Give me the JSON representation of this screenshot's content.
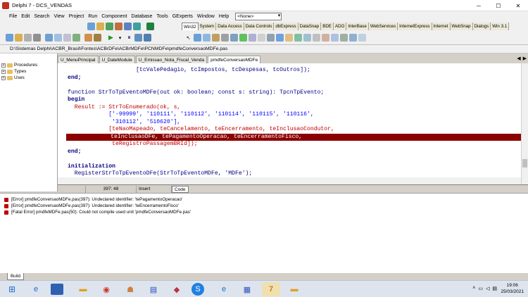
{
  "window": {
    "title": "Delphi 7 - DCS_VENDAS"
  },
  "menu": {
    "items": [
      "File",
      "Edit",
      "Search",
      "View",
      "Project",
      "Run",
      "Component",
      "Database",
      "Tools",
      "GExperts",
      "Window",
      "Help"
    ],
    "config_combo": "<None>"
  },
  "palette": {
    "tabs": [
      "Win32",
      "System",
      "Data Access",
      "Data Controls",
      "dbExpress",
      "DataSnap",
      "BDE",
      "ADO",
      "InterBase",
      "WebServices",
      "InternetExpress",
      "Internet",
      "WebSnap",
      "Dialogs",
      "Win 3.1"
    ]
  },
  "pathbar": {
    "path": "D:\\Sistemas Delphi\\ACBR_Brasil\\Fontes\\ACBrDFe\\ACBrMDFe\\PCNMDFe\\pmdfeConversaoMDFe.pas"
  },
  "tree": {
    "items": [
      "Procedures",
      "Types",
      "Uses"
    ]
  },
  "editor": {
    "tabs": [
      "U_MenuPrincipal",
      "U_DateModule",
      "U_Emissao_Nota_Fiscal_Venda",
      "pmdfeConversaoMDFe"
    ],
    "lines": [
      "                    [tcValePedagio, tcImpostos, tcDespesas, tcOutros]);",
      "end;",
      "",
      "function StrToTpEventoMDFe(out ok: boolean; const s: string): TpcnTpEvento;",
      "begin",
      "  Result := StrToEnumerado(ok, s,",
      "            ['-99999', '110111', '110112', '110114', '110115', '110116',",
      "             '310112', '510620'],",
      "            [teNaoMapeado, teCancelamento, teEncerramento, teInclusaoCondutor,",
      "             teInclusaoDFe, tePagamentoOperacao, teEncerramentoFisco,",
      "             teRegistroPassagemBRId]);",
      "end;",
      "",
      "initialization",
      "  RegisterStrToTpEventoDFe(StrToTpEventoMDFe, 'MDFe');"
    ]
  },
  "status": {
    "position": "397: 48",
    "mode": "Insert",
    "code_tab": "Code"
  },
  "messages": [
    "[Error] pmdfeConversaoMDFe.pas(397): Undeclared identifier: 'tePagamentoOperacao'",
    "[Error] pmdfeConversaoMDFe.pas(397): Undeclared identifier: 'teEncerramentoFisco'",
    "[Fatal Error] pmdfeMDFe.pas(50): Could not compile used unit 'pmdfeConversaoMDFe.pas'"
  ],
  "build_tab": "Build",
  "clock": {
    "time": "19:06",
    "date": "25/03/2021"
  },
  "colors": {
    "highlight_line": "#8b0000",
    "keyword": "#000080",
    "string": "#0000ff"
  }
}
